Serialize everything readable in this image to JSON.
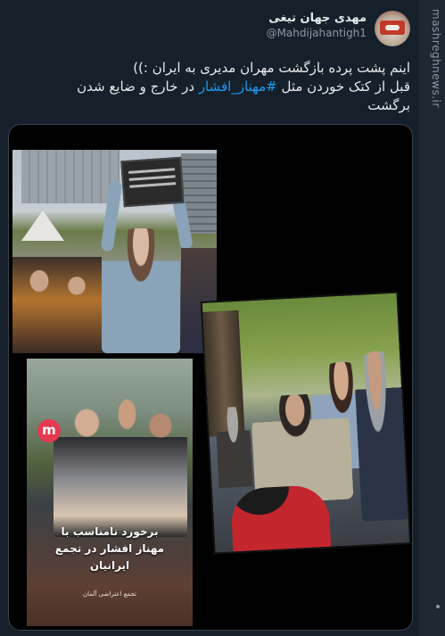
{
  "tweet": {
    "display_name": "مهدی جهان تیغی",
    "handle": "@Mahdijahantigh1",
    "text_line1": "اینم پشت پرده بازگشت مهران مدیری به ایران :))",
    "text_line2_before": "قبل از کتک خوردن مثل ",
    "hashtag": "#مهناز_افشار",
    "text_line2_after": " در خارج و ضایع شدن",
    "text_line3": "برگشت"
  },
  "media": {
    "video_caption_line1": "برخورد نامناسب با",
    "video_caption_line2": "مهناز افشار در تجمع",
    "video_caption_line3": "ایرانیان",
    "video_credit": "تجمع اعتراضی آلمان",
    "video_logo_letter": "m"
  },
  "watermark": "mashreghnews.ir",
  "icons": {
    "avatar": "profile-avatar",
    "video_logo": "m-logo-icon"
  },
  "colors": {
    "background": "#15202b",
    "hashtag": "#1d9bf0",
    "secondary_text": "#8b98a5"
  }
}
